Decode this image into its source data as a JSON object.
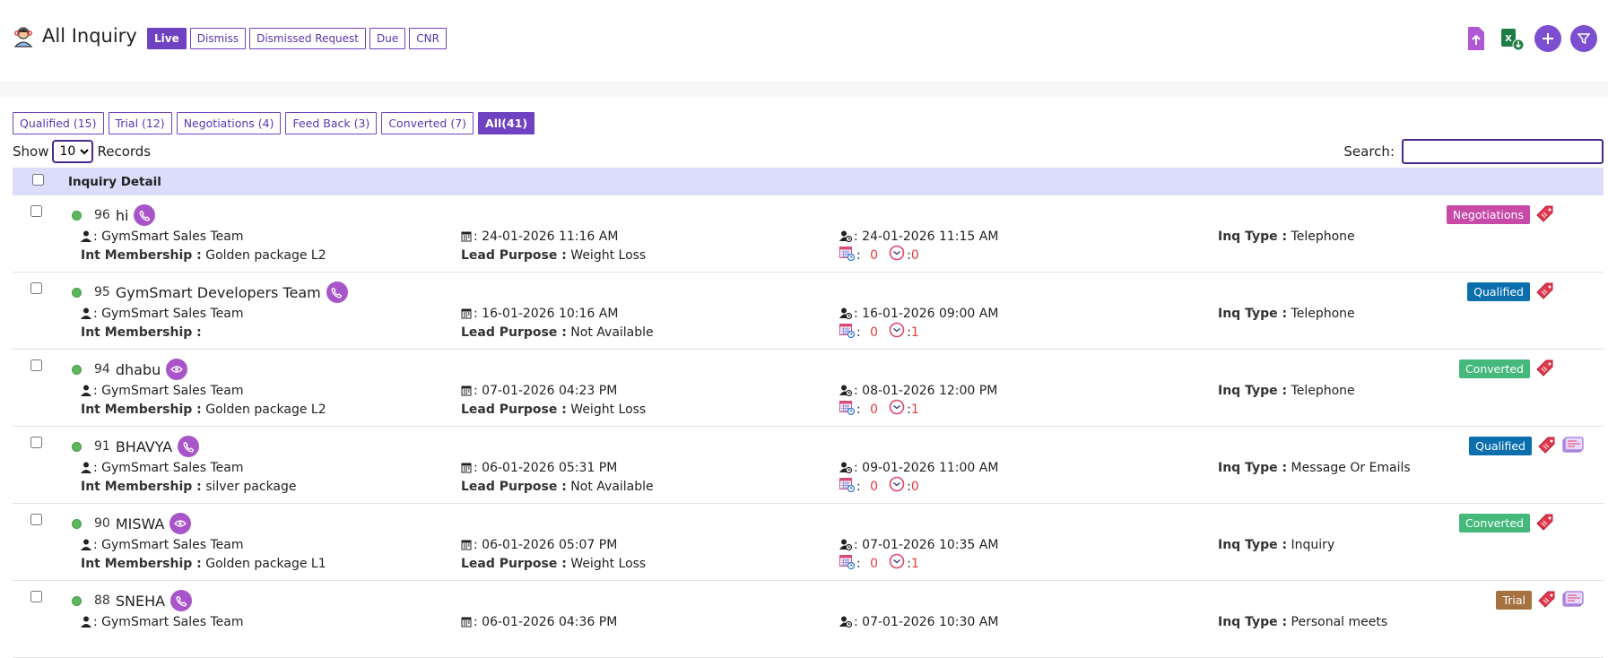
{
  "header": {
    "title": "All Inquiry",
    "status_tabs": [
      "Live",
      "Dismiss",
      "Dismissed Request",
      "Due",
      "CNR"
    ],
    "active_status_tab": "Live",
    "actions": [
      "upload-icon",
      "excel-download-icon",
      "add-icon",
      "filter-icon"
    ]
  },
  "filters": {
    "tabs": [
      "Qualified (15)",
      "Trial (12)",
      "Negotiations (4)",
      "Feed Back (3)",
      "Converted (7)",
      "All(41)"
    ],
    "active": "All(41)"
  },
  "controls": {
    "show_label": "Show",
    "page_size": "10",
    "page_size_options": [
      "10"
    ],
    "records_label": "Records",
    "search_label": "Search:",
    "search_value": ""
  },
  "table": {
    "header": "Inquiry Detail",
    "labels": {
      "int_membership": "Int Membership :",
      "lead_purpose": "Lead Purpose :",
      "inq_type": "Inq Type :"
    },
    "rows": [
      {
        "id": "96",
        "name": "hi",
        "mode": "phone-icon",
        "team": ": GymSmart Sales Team",
        "membership": "Golden package L2",
        "created": ": 24-01-2026 11:16 AM",
        "purpose": "Weight Loss",
        "followup": ": 24-01-2026 11:15 AM",
        "count_a": "0",
        "count_b": "0",
        "inq_type": "Telephone",
        "stage": "Negotiations",
        "stage_color": "#c84aa8",
        "extra_icon": false
      },
      {
        "id": "95",
        "name": "GymSmart Developers Team",
        "mode": "phone-icon",
        "team": ": GymSmart Sales Team",
        "membership": "",
        "created": ": 16-01-2026 10:16 AM",
        "purpose": "Not Available",
        "followup": ": 16-01-2026 09:00 AM",
        "count_a": "0",
        "count_b": "1",
        "inq_type": "Telephone",
        "stage": "Qualified",
        "stage_color": "#0b6fae",
        "extra_icon": false
      },
      {
        "id": "94",
        "name": "dhabu",
        "mode": "eye-icon",
        "team": ": GymSmart Sales Team",
        "membership": "Golden package L2",
        "created": ": 07-01-2026 04:23 PM",
        "purpose": "Weight Loss",
        "followup": ": 08-01-2026 12:00 PM",
        "count_a": "0",
        "count_b": "1",
        "inq_type": "Telephone",
        "stage": "Converted",
        "stage_color": "#45b97c",
        "extra_icon": false
      },
      {
        "id": "91",
        "name": "BHAVYA",
        "mode": "phone-icon",
        "team": ": GymSmart Sales Team",
        "membership": "silver package",
        "created": ": 06-01-2026 05:31 PM",
        "purpose": "Not Available",
        "followup": ": 09-01-2026 11:00 AM",
        "count_a": "0",
        "count_b": "0",
        "inq_type": "Message Or Emails",
        "stage": "Qualified",
        "stage_color": "#0b6fae",
        "extra_icon": true
      },
      {
        "id": "90",
        "name": "MISWA",
        "mode": "eye-icon",
        "team": ": GymSmart Sales Team",
        "membership": "Golden package L1",
        "created": ": 06-01-2026 05:07 PM",
        "purpose": "Weight Loss",
        "followup": ": 07-01-2026 10:35 AM",
        "count_a": "0",
        "count_b": "1",
        "inq_type": "Inquiry",
        "stage": "Converted",
        "stage_color": "#45b97c",
        "extra_icon": false
      },
      {
        "id": "88",
        "name": "SNEHA",
        "mode": "phone-icon",
        "team": ": GymSmart Sales Team",
        "membership": "",
        "created": ": 06-01-2026 04:36 PM",
        "purpose": "",
        "followup": ": 07-01-2026 10:30 AM",
        "count_a": "",
        "count_b": "",
        "inq_type": "Personal meets",
        "stage": "Trial",
        "stage_color": "#a5713f",
        "extra_icon": true
      }
    ]
  }
}
